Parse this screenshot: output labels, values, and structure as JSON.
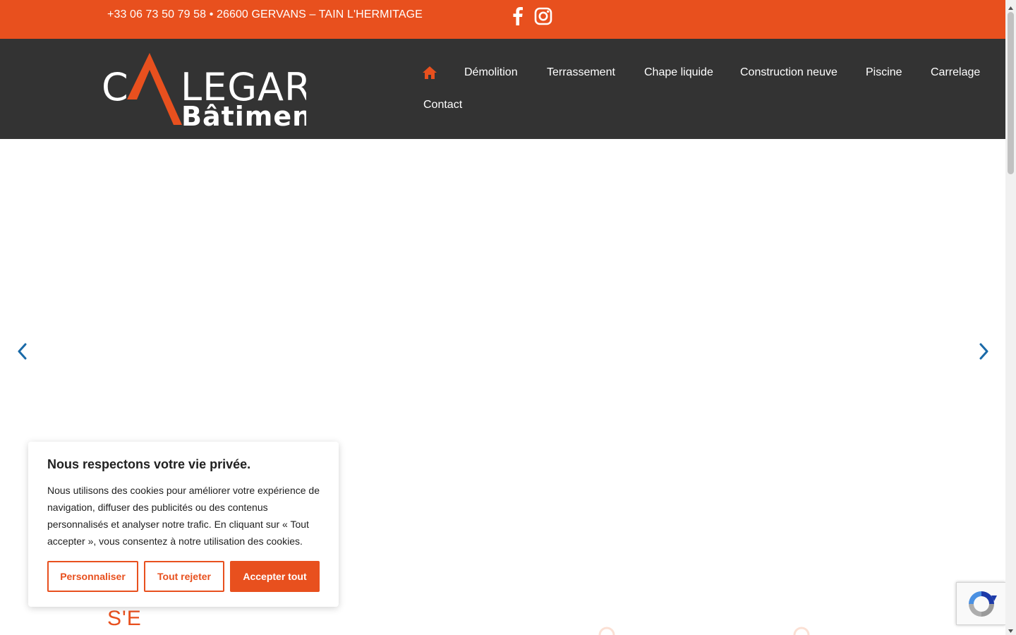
{
  "topbar": {
    "contact": "+33 06 73 50 79 58 • 26600 GERVANS – TAIN L'HERMITAGE",
    "social": [
      "facebook-icon",
      "instagram-icon"
    ],
    "background": "#e8501e"
  },
  "header": {
    "background": "#333333",
    "logo": {
      "line1": "CALEGARI",
      "line2": "Bâtiment"
    },
    "nav": {
      "home_icon": "home-icon",
      "items": [
        "Démolition",
        "Terrassement",
        "Chape liquide",
        "Construction neuve",
        "Piscine",
        "Carrelage",
        "Contact"
      ]
    }
  },
  "hero": {
    "prev_icon": "chevron-left-icon",
    "next_icon": "chevron-right-icon"
  },
  "section": {
    "title_partial": "S'E"
  },
  "cookie_banner": {
    "title": "Nous respectons votre vie privée.",
    "text": "Nous utilisons des cookies pour améliorer votre expérience de navigation, diffuser des publicités ou des contenus personnalisés et analyser notre trafic. En cliquant sur « Tout accepter », vous consentez à notre utilisation des cookies.",
    "buttons": {
      "customize": "Personnaliser",
      "reject": "Tout rejeter",
      "accept": "Accepter tout"
    }
  },
  "colors": {
    "accent": "#e8501e",
    "dark": "#333333",
    "arrow": "#1a6aa8"
  },
  "recaptcha": {
    "icon": "recaptcha-icon"
  }
}
